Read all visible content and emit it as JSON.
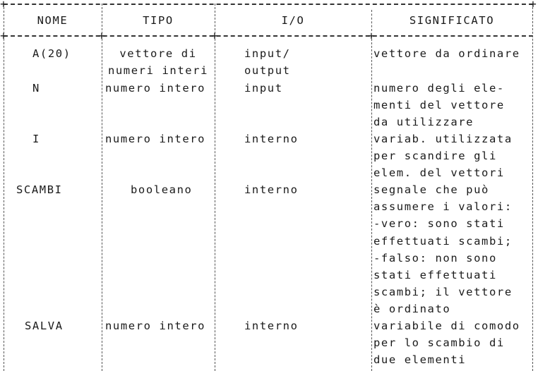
{
  "table": {
    "headers": [
      "NOME",
      "TIPO",
      "I/O",
      "SIGNIFICATO"
    ],
    "rows": [
      {
        "nome": "A(20)",
        "tipo": "vettore di\nnumeri interi",
        "io": "input/\noutput",
        "significato": "vettore da ordinare"
      },
      {
        "nome": "N",
        "tipo": "numero intero",
        "io": "input",
        "significato": "numero degli ele-\nmenti del vettore\nda utilizzare"
      },
      {
        "nome": "I",
        "tipo": "numero intero",
        "io": "interno",
        "significato": "variab. utilizzata\nper scandire gli\nelem. del vettori"
      },
      {
        "nome": "SCAMBI",
        "tipo": "booleano",
        "io": "interno",
        "significato": "segnale che può\nassumere i valori:\n-vero: sono stati\neffettuati scambi;\n-falso: non sono\nstati effettuati\nscambi; il vettore\nè ordinato"
      },
      {
        "nome": "SALVA",
        "tipo": "numero intero",
        "io": "interno",
        "significato": "variabile di comodo\nper lo scambio di\ndue elementi"
      }
    ]
  }
}
